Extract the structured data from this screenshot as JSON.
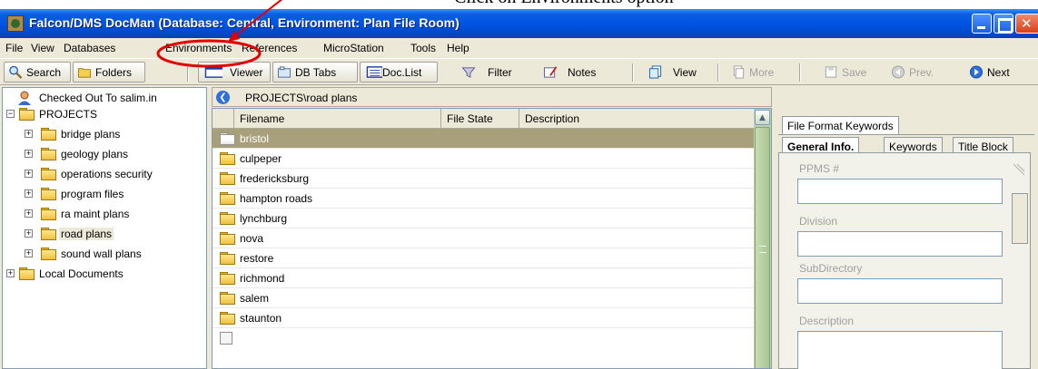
{
  "annotation": {
    "text": "Click on Environments option"
  },
  "window": {
    "title": "Falcon/DMS DocMan (Database: Central, Environment: Plan File Room)"
  },
  "menu": [
    "File",
    "View",
    "Databases",
    "Environments",
    "References",
    "MicroStation",
    "Tools",
    "Help"
  ],
  "toolbar": {
    "search": "Search",
    "folders": "Folders",
    "viewer": "Viewer",
    "db_tabs": "DB Tabs",
    "doc_list": "Doc.List",
    "filter": "Filter",
    "notes": "Notes",
    "view": "View",
    "more": "More",
    "save": "Save",
    "prev": "Prev.",
    "next": "Next"
  },
  "tree": {
    "checked_out": "Checked Out To salim.in",
    "root": "PROJECTS",
    "children": [
      "bridge plans",
      "geology plans",
      "operations security",
      "program files",
      "ra maint plans",
      "road plans",
      "sound wall plans"
    ],
    "local": "Local Documents"
  },
  "grid": {
    "path": "PROJECTS\\road plans",
    "columns": [
      "Filename",
      "File State",
      "Description"
    ],
    "rows": [
      "bristol",
      "culpeper",
      "fredericksburg",
      "hampton roads",
      "lynchburg",
      "nova",
      "restore",
      "richmond",
      "salem",
      "staunton"
    ]
  },
  "right_pane": {
    "outer_tab": "File Format Keywords",
    "tabs": [
      "General Info.",
      "Keywords",
      "Title Block"
    ],
    "fields": [
      "PPMS #",
      "Division",
      "SubDirectory",
      "Description"
    ]
  },
  "colors": {
    "annotation_red": "#e00000",
    "titlebar": "#0054e3",
    "selection": "#a8a07a"
  }
}
